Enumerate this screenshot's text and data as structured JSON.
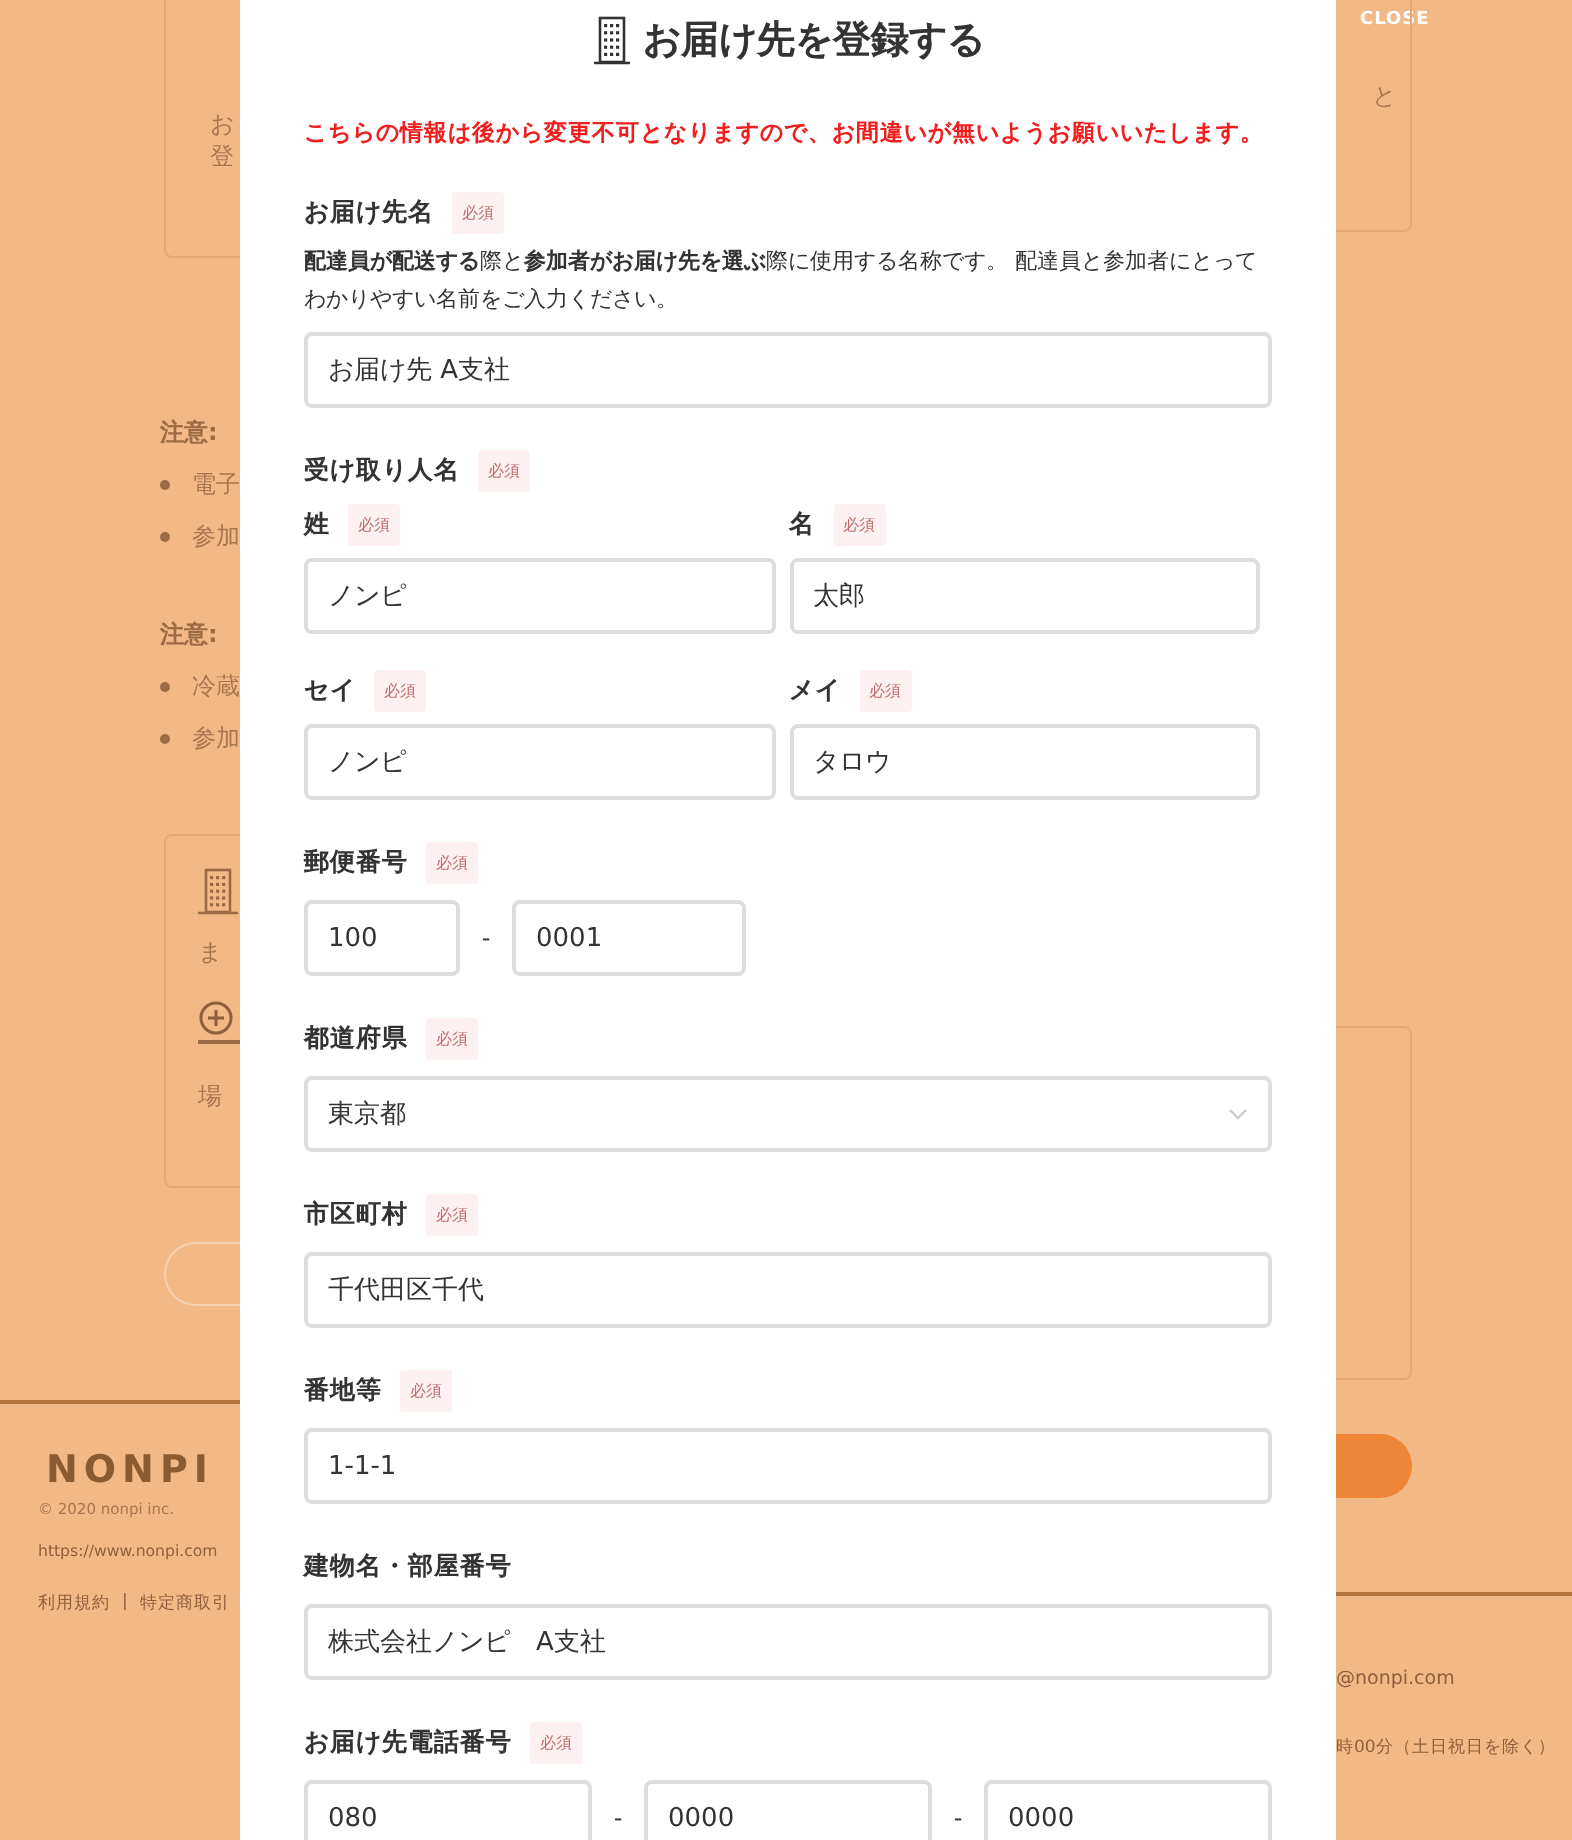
{
  "background": {
    "top_card": {
      "left_lines": [
        "お",
        "登"
      ],
      "right_lines": [
        "と"
      ]
    },
    "notices": [
      {
        "heading": "注意:",
        "bullets": [
          "電子",
          "参加"
        ]
      },
      {
        "heading": "注意:",
        "bullets": [
          "冷蔵",
          "参加"
        ]
      }
    ],
    "location_card": {
      "lines": [
        "ま",
        "場"
      ]
    },
    "footer": {
      "logo": "NONPI",
      "copyright": "© 2020 nonpi inc.",
      "url": "https://www.nonpi.com",
      "links": [
        "利用規約",
        "特定商取引"
      ],
      "separator": "|",
      "email": "@nonpi.com",
      "hours": "時00分（土日祝日を除く）"
    }
  },
  "modal": {
    "close": "CLOSE",
    "title": "お届け先を登録する",
    "warning": "こちらの情報は後から変更不可となりますので、お間違いが無いようお願いいたします。",
    "fields": [
      {
        "kind": "text",
        "label": "お届け先名",
        "badge": "必須",
        "description": "**配達員が配送する**際と**参加者がお届け先を選ぶ**際に使用する名称です。 配達員と参加者にとってわかりやすい名前をご入力ください。",
        "value": "お届け先 A支社"
      },
      {
        "kind": "pair",
        "label": "受け取り人名",
        "badge": "必須",
        "parts": [
          {
            "label": "姓",
            "badge": "必須",
            "value": "ノンピ"
          },
          {
            "label": "名",
            "badge": "必須",
            "value": "太郎"
          }
        ]
      },
      {
        "kind": "pair",
        "parts": [
          {
            "label": "セイ",
            "badge": "必須",
            "value": "ノンピ"
          },
          {
            "label": "メイ",
            "badge": "必須",
            "value": "タロウ"
          }
        ]
      },
      {
        "kind": "split",
        "label": "郵便番号",
        "badge": "必須",
        "values": [
          "100",
          "0001"
        ],
        "separators": [
          "-"
        ]
      },
      {
        "kind": "select",
        "label": "都道府県",
        "badge": "必須",
        "value": "東京都"
      },
      {
        "kind": "text",
        "label": "市区町村",
        "badge": "必須",
        "value": "千代田区千代"
      },
      {
        "kind": "text",
        "label": "番地等",
        "badge": "必須",
        "value": "1-1-1"
      },
      {
        "kind": "text",
        "label": "建物名・部屋番号",
        "value": "株式会社ノンピ　A支社"
      },
      {
        "kind": "split",
        "label": "お届け先電話番号",
        "badge": "必須",
        "values": [
          "080",
          "0000",
          "0000"
        ],
        "separators": [
          "-",
          "-"
        ]
      }
    ]
  }
}
